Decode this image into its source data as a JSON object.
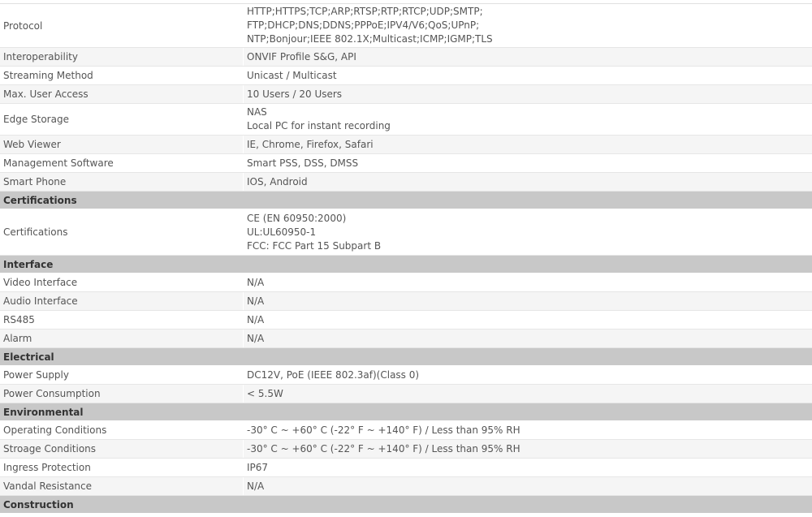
{
  "rows_network": [
    {
      "label": "Protocol",
      "lines": [
        "HTTP;HTTPS;TCP;ARP;RTSP;RTP;RTCP;UDP;SMTP;",
        "FTP;DHCP;DNS;DDNS;PPPoE;IPV4/V6;QoS;UPnP;",
        "NTP;Bonjour;IEEE 802.1X;Multicast;ICMP;IGMP;TLS"
      ]
    },
    {
      "label": "Interoperability",
      "lines": [
        "ONVIF Profile S&G, API"
      ]
    },
    {
      "label": "Streaming Method",
      "lines": [
        "Unicast / Multicast"
      ]
    },
    {
      "label": "Max. User Access",
      "lines": [
        "10 Users / 20 Users"
      ]
    },
    {
      "label": "Edge Storage",
      "lines": [
        "NAS",
        "Local PC for instant recording"
      ]
    },
    {
      "label": "Web Viewer",
      "lines": [
        "IE, Chrome, Firefox, Safari"
      ]
    },
    {
      "label": "Management Software",
      "lines": [
        "Smart PSS, DSS, DMSS"
      ]
    },
    {
      "label": "Smart Phone",
      "lines": [
        "IOS, Android"
      ]
    }
  ],
  "sections": {
    "certifications": "Certifications",
    "interface": "Interface",
    "electrical": "Electrical",
    "environmental": "Environmental",
    "construction": "Construction"
  },
  "rows_certifications": [
    {
      "label": "Certifications",
      "lines": [
        "CE (EN 60950:2000)",
        "UL:UL60950-1",
        "FCC: FCC Part 15 Subpart B"
      ]
    }
  ],
  "rows_interface": [
    {
      "label": "Video Interface",
      "lines": [
        "N/A"
      ]
    },
    {
      "label": "Audio Interface",
      "lines": [
        "N/A"
      ]
    },
    {
      "label": "RS485",
      "lines": [
        "N/A"
      ]
    },
    {
      "label": "Alarm",
      "lines": [
        "N/A"
      ]
    }
  ],
  "rows_electrical": [
    {
      "label": "Power Supply",
      "lines": [
        "DC12V, PoE (IEEE 802.3af)(Class 0)"
      ]
    },
    {
      "label": "Power Consumption",
      "lines": [
        "< 5.5W"
      ]
    }
  ],
  "rows_environmental": [
    {
      "label": "Operating Conditions",
      "lines": [
        "-30° C ~ +60° C (-22° F ~ +140° F) / Less than 95% RH"
      ]
    },
    {
      "label": "Stroage Conditions",
      "lines": [
        "-30° C ~ +60° C (-22° F ~ +140° F) / Less than 95% RH"
      ]
    },
    {
      "label": "Ingress Protection",
      "lines": [
        "IP67"
      ]
    },
    {
      "label": "Vandal Resistance",
      "lines": [
        "N/A"
      ]
    }
  ]
}
